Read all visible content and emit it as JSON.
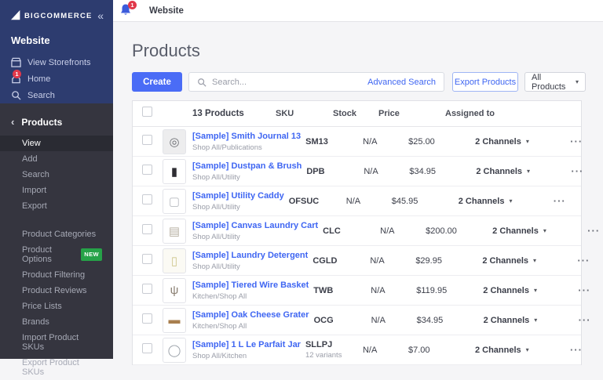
{
  "colors": {
    "sidebar_top_bg": "#2d3c6f",
    "sidebar_bottom_bg": "#35353f",
    "accent_blue": "#3f66f2",
    "create_button_blue": "#4a6cf6",
    "badge_red": "#e1384a",
    "new_badge_green": "#26a248",
    "main_bg": "#f5f5f7"
  },
  "icons": {
    "collapse": "«",
    "back_chevron": "‹",
    "caret_down": "▾",
    "ellipsis": "···"
  },
  "sidebar": {
    "logo_text": "BIGCOMMERCE",
    "store_name": "Website",
    "top_items": [
      {
        "label": "View Storefronts",
        "icon": "storefront-icon"
      },
      {
        "label": "Home",
        "icon": "home-icon",
        "badge": "1"
      },
      {
        "label": "Search",
        "icon": "search-icon"
      }
    ],
    "section": {
      "label": "Products",
      "items": [
        {
          "label": "View",
          "active": true
        },
        {
          "label": "Add"
        },
        {
          "label": "Search"
        },
        {
          "label": "Import"
        },
        {
          "label": "Export"
        }
      ],
      "items2": [
        {
          "label": "Product Categories"
        },
        {
          "label": "Product Options",
          "badge": "NEW"
        },
        {
          "label": "Product Filtering"
        },
        {
          "label": "Product Reviews"
        },
        {
          "label": "Price Lists"
        },
        {
          "label": "Brands"
        },
        {
          "label": "Import Product SKUs"
        },
        {
          "label": "Export Product SKUs"
        }
      ]
    }
  },
  "topbar": {
    "tab_label": "Website",
    "notification_badge": "1"
  },
  "page": {
    "title": "Products"
  },
  "toolbar": {
    "create_label": "Create",
    "search_placeholder": "Search...",
    "advanced_search_label": "Advanced Search",
    "export_label": "Export Products",
    "filter_label": "All Products"
  },
  "table": {
    "header": {
      "count_label": "13 Products",
      "sku": "SKU",
      "stock": "Stock",
      "price": "Price",
      "assigned": "Assigned to"
    },
    "rows": [
      {
        "name": "[Sample] Smith Journal 13",
        "category": "Shop All/Publications",
        "sku": "SM13",
        "stock": "N/A",
        "price": "$25.00",
        "assigned": "2 Channels",
        "thumb": {
          "glyph": "◎",
          "color": "#6d6f74",
          "bg": "#ededee"
        }
      },
      {
        "name": "[Sample] Dustpan & Brush",
        "category": "Shop All/Utility",
        "sku": "DPB",
        "stock": "N/A",
        "price": "$34.95",
        "assigned": "2 Channels",
        "thumb": {
          "glyph": "▮",
          "color": "#2e2d33",
          "bg": "#ffffff"
        }
      },
      {
        "name": "[Sample] Utility Caddy",
        "category": "Shop All/Utility",
        "sku": "OFSUC",
        "stock": "N/A",
        "price": "$45.95",
        "assigned": "2 Channels",
        "thumb": {
          "glyph": "▢",
          "color": "#b9bcc1",
          "bg": "#ffffff"
        }
      },
      {
        "name": "[Sample] Canvas Laundry Cart",
        "category": "Shop All/Utility",
        "sku": "CLC",
        "stock": "N/A",
        "price": "$200.00",
        "assigned": "2 Channels",
        "thumb": {
          "glyph": "▤",
          "color": "#b8b2a4",
          "bg": "#ffffff"
        }
      },
      {
        "name": "[Sample] Laundry Detergent",
        "category": "Shop All/Utility",
        "sku": "CGLD",
        "stock": "N/A",
        "price": "$29.95",
        "assigned": "2 Channels",
        "thumb": {
          "glyph": "▯",
          "color": "#cfc68c",
          "bg": "#fbfaf4"
        }
      },
      {
        "name": "[Sample] Tiered Wire Basket",
        "category": "Kitchen/Shop All",
        "sku": "TWB",
        "stock": "N/A",
        "price": "$119.95",
        "assigned": "2 Channels",
        "thumb": {
          "glyph": "ψ",
          "color": "#8a7f72",
          "bg": "#ffffff"
        }
      },
      {
        "name": "[Sample] Oak Cheese Grater",
        "category": "Kitchen/Shop All",
        "sku": "OCG",
        "stock": "N/A",
        "price": "$34.95",
        "assigned": "2 Channels",
        "thumb": {
          "glyph": "▬",
          "color": "#a87f4f",
          "bg": "#ffffff"
        }
      },
      {
        "name": "[Sample] 1 L Le Parfait Jar",
        "category": "Shop All/Kitchen",
        "sku": "SLLPJ",
        "variants": "12 variants",
        "stock": "N/A",
        "price": "$7.00",
        "assigned": "2 Channels",
        "thumb": {
          "glyph": "◯",
          "color": "#9aa0a8",
          "bg": "#ffffff"
        }
      }
    ]
  }
}
